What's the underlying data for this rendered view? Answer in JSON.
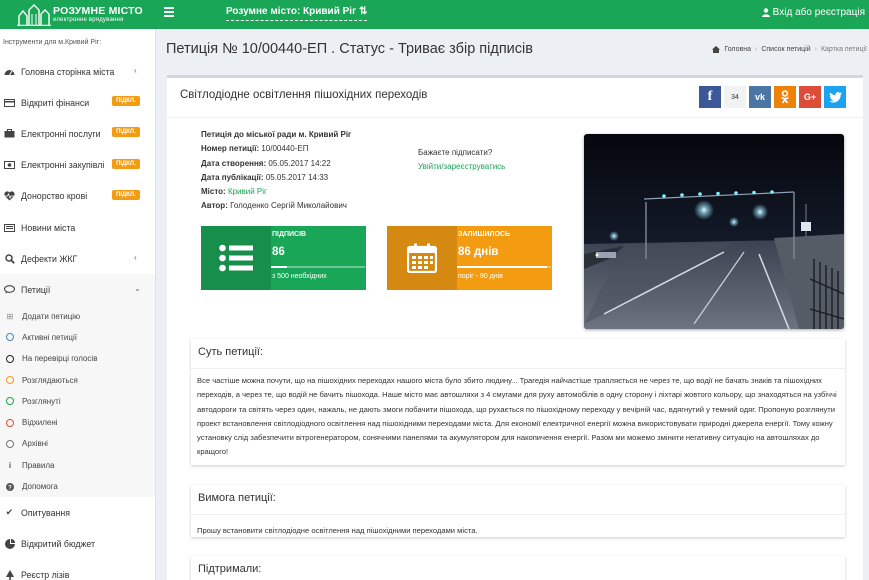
{
  "topbar": {
    "logo_title": "РОЗУМНЕ МІСТО",
    "logo_subtitle": "електронне врядування",
    "city_selector": "Розумне місто: Кривий Ріг",
    "login_label": "Вхід або реєстрація"
  },
  "sidebar": {
    "header": "Інструменти для м.Кривий Ріг:",
    "items": [
      {
        "label": "Головна сторінка міста",
        "icon": "tachometer-icon",
        "has_chevron": true
      },
      {
        "label": "Відкриті фінанси",
        "icon": "credit-card-icon",
        "badge": "ПІДКЛ."
      },
      {
        "label": "Електронні послуги",
        "icon": "briefcase-icon",
        "badge": "ПІДКЛ."
      },
      {
        "label": "Електронні закупівлі",
        "icon": "money-icon",
        "badge": "ПІДКЛ."
      },
      {
        "label": "Донорство крові",
        "icon": "heartbeat-icon",
        "badge": "ПІДКЛ."
      },
      {
        "label": "Новини міста",
        "icon": "newspaper-icon"
      },
      {
        "label": "Дефекти ЖКГ",
        "icon": "search-icon",
        "has_chevron": true
      },
      {
        "label": "Петиції",
        "icon": "comments-icon",
        "has_chevron": true,
        "open": true
      }
    ],
    "petition_subitems": [
      {
        "label": "Додати петицію",
        "icon": "plus-square-icon"
      },
      {
        "label": "Активні петиції",
        "icon": "circle-icon",
        "color": "#3c8dbc"
      },
      {
        "label": "На перевірці голосів",
        "icon": "circle-icon",
        "color": "#222222"
      },
      {
        "label": "Розглядаються",
        "icon": "circle-icon",
        "color": "#f39c12"
      },
      {
        "label": "Розглянуті",
        "icon": "circle-icon",
        "color": "#1aa657"
      },
      {
        "label": "Відхилені",
        "icon": "circle-icon",
        "color": "#dd4b39"
      },
      {
        "label": "Архівні",
        "icon": "circle-icon",
        "color": "#777777"
      },
      {
        "label": "Правила",
        "icon": "info-icon"
      },
      {
        "label": "Допомога",
        "icon": "question-circle-icon"
      }
    ],
    "bottom_items": [
      {
        "label": "Опитування",
        "icon": "check-icon"
      },
      {
        "label": "Відкритий бюджет",
        "icon": "pie-chart-icon"
      },
      {
        "label": "Реєстр лізів",
        "icon": "tree-icon"
      }
    ]
  },
  "main": {
    "page_title": "Петиція № 10/00440-ЕП . Статус - Триває збір підписів",
    "breadcrumb": [
      "Головна",
      "Список петицій",
      "Картка петиції"
    ],
    "petition_title": "Світлодіодне освітлення пішохідних переходів",
    "share": {
      "count": "34",
      "networks": [
        "facebook-icon",
        "vk-icon",
        "odnoklassniki-icon",
        "google-plus-icon",
        "twitter-icon"
      ],
      "colors": [
        "#3b5998",
        "#4c75a3",
        "#ee8208",
        "#dd4b39",
        "#1da1f2"
      ]
    },
    "meta": {
      "addressee": "Петиція до міської ради м. Кривий Ріг",
      "number_label": "Номер петиції",
      "number_value": "10/00440-ЕП",
      "created_label": "Дата створення",
      "created_value": "05.05.2017 14:22",
      "published_label": "Дата публікації",
      "published_value": "05.05.2017 14:33",
      "city_label": "Місто",
      "city_value": "Кривий Ріг",
      "author_label": "Автор",
      "author_value": "Голоденко Сергій Миколайович"
    },
    "sign": {
      "question": "Бажаєте підписати?",
      "link": "Увійти/зареєструватись"
    },
    "stats": {
      "signatures_label": "ПІДПИСІВ",
      "signatures_value": "86",
      "signatures_progress": 0.172,
      "signatures_desc": "з 500 необхідних",
      "remaining_label": "ЗАЛИШИЛОСЬ",
      "remaining_value": "86 днів",
      "remaining_progress": 0.956,
      "remaining_desc": "поріг - 90 днів"
    },
    "essence_title": "Суть петиції:",
    "essence_text": "Все частіше можна почути, що на пішохідних переходах нашого міста було збито людину... Трагедія найчастіше трапляється не через те, що водії не бачать знаків та пішохідних переходів, а через те, що водій не бачить пішохода. Наше місто має автошляхи з 4 смугами для руху автомобілів в одну сторону і ліхтарі жовтого кольору, що знаходяться на узбіччі автодороги та світять через один, нажаль, не дають змоги побачити пішохода, що рухається по пішохідному переходу у вечірній час, вдягнутий у темний одяг. Пропоную розглянути проект встановлення світлодіодного освітлення над пішохідними переходами міста. Для економії електричної енергії можна використовувати природні джерела енергії. Тому кожну установку слід забезпечити вітрогенератором, сонячними панелями та акумулятором для накопичення енергії. Разом ми можемо змінити негативну ситуацію на автошляхах до кращого!",
    "demand_title": "Вимога петиції:",
    "demand_text": "Прошу встановити світлодіодне освітлення над пішохідними переходами міста.",
    "supporters_title": "Підтримали:"
  }
}
